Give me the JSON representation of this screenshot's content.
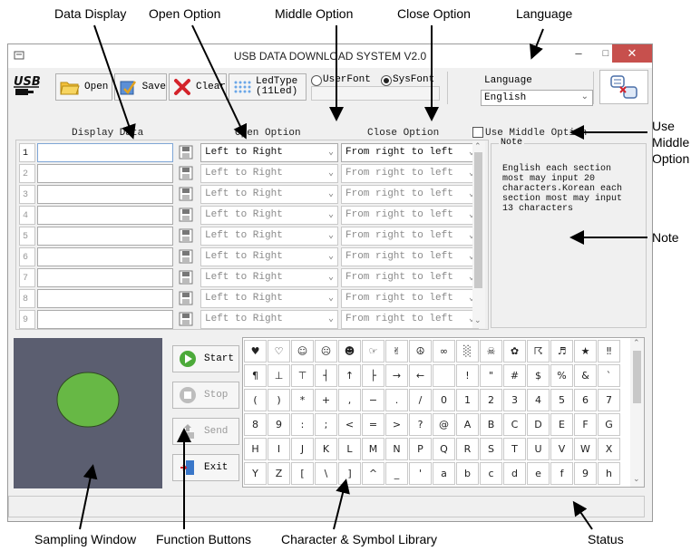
{
  "callouts": {
    "data_display": "Data Display",
    "open_option": "Open  Option",
    "middle_option": "Middle Option",
    "close_option": "Close Option",
    "language": "Language",
    "use_middle_option_1": "Use",
    "use_middle_option_2": "Middle",
    "use_middle_option_3": "Option",
    "note": "Note",
    "sampling_window": "Sampling Window",
    "function_buttons": "Function Buttons",
    "char_library": "Character & Symbol Library",
    "status": "Status"
  },
  "window": {
    "title": "USB DATA DOWNLOAD SYSTEM V2.0",
    "minimize": "–",
    "maximize": "□",
    "close": "✕"
  },
  "toolbar": {
    "open": "Open",
    "save": "Save",
    "clear": "Clear",
    "ledtype_line1": "LedType",
    "ledtype_line2": "(11Led)",
    "userfont": "UserFont",
    "sysfont": "SysFont",
    "language_label": "Language",
    "language_value": "English"
  },
  "headers": {
    "display_data": "Display Data",
    "open_option": "Open Option",
    "close_option": "Close Option",
    "use_middle_option": "Use Middle Option",
    "note_title": "Note"
  },
  "rows": [
    {
      "num": "1",
      "open": "Left to Right",
      "close": "From right to left"
    },
    {
      "num": "2",
      "open": "Left to Right",
      "close": "From right to left"
    },
    {
      "num": "3",
      "open": "Left to Right",
      "close": "From right to left"
    },
    {
      "num": "4",
      "open": "Left to Right",
      "close": "From right to left"
    },
    {
      "num": "5",
      "open": "Left to Right",
      "close": "From right to left"
    },
    {
      "num": "6",
      "open": "Left to Right",
      "close": "From right to left"
    },
    {
      "num": "7",
      "open": "Left to Right",
      "close": "From right to left"
    },
    {
      "num": "8",
      "open": "Left to Right",
      "close": "From right to left"
    },
    {
      "num": "9",
      "open": "Left to Right",
      "close": "From right to left"
    }
  ],
  "note_text": "English each section most may input 20 characters.Korean each section most may input 13 characters",
  "functions": {
    "start": "Start",
    "stop": "Stop",
    "send": "Send",
    "exit": "Exit"
  },
  "chars": [
    [
      "♥",
      "♡",
      "☺",
      "☹",
      "☻",
      "☞",
      "✌",
      "☮",
      "∞",
      "░",
      "☠",
      "✿",
      "☈",
      "♬",
      "★",
      "‼"
    ],
    [
      "¶",
      "⊥",
      "⊤",
      "┤",
      "↑",
      "├",
      "→",
      "←",
      " ",
      "!",
      "\"",
      "#",
      "$",
      "%",
      "&",
      "`"
    ],
    [
      "(",
      ")",
      "*",
      "+",
      ",",
      "−",
      ".",
      "/",
      "0",
      "1",
      "2",
      "3",
      "4",
      "5",
      "6",
      "7"
    ],
    [
      "8",
      "9",
      ":",
      ";",
      "<",
      "=",
      ">",
      "?",
      "@",
      "A",
      "B",
      "C",
      "D",
      "E",
      "F",
      "G"
    ],
    [
      "H",
      "I",
      "J",
      "K",
      "L",
      "M",
      "N",
      "P",
      "Q",
      "R",
      "S",
      "T",
      "U",
      "V",
      "W",
      "X"
    ],
    [
      "Y",
      "Z",
      "[",
      "\\",
      "]",
      "^",
      "_",
      "'",
      "a",
      "b",
      "c",
      "d",
      "e",
      "f",
      "9",
      "h"
    ]
  ],
  "colors": {
    "accent_green": "#67b845",
    "sampling_bg": "#5b5e70",
    "close_red": "#c7504d"
  }
}
